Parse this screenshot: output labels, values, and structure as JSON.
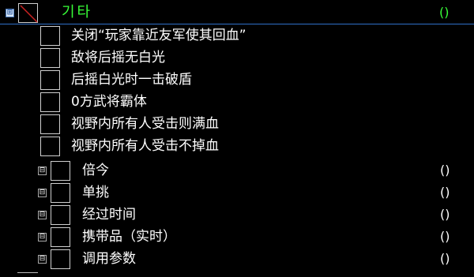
{
  "header": {
    "expander_symbol": "⊞",
    "label": "기타",
    "value": "()"
  },
  "cheats": [
    {
      "label": "关闭“玩家靠近友军使其回血”"
    },
    {
      "label": "敌将后摇无白光"
    },
    {
      "label": "后摇白光时一击破盾"
    },
    {
      "label": "0方武将霸体"
    },
    {
      "label": "视野内所有人受击则满血"
    },
    {
      "label": "视野内所有人受击不掉血"
    }
  ],
  "groups": [
    {
      "expander_symbol": "⊟",
      "label": "倍今",
      "value": "()"
    },
    {
      "expander_symbol": "⊟",
      "label": "单挑",
      "value": "()"
    },
    {
      "expander_symbol": "⊟",
      "label": "经过时间",
      "value": "()"
    },
    {
      "expander_symbol": "⊟",
      "label": "携带品（实时）",
      "value": "()"
    },
    {
      "expander_symbol": "⊟",
      "label": "调用参数",
      "value": "()"
    }
  ],
  "colors": {
    "background": "#000000",
    "header_text": "#38ff38",
    "header_underline": "#2f6fc8",
    "cross_mark": "#cc2222"
  }
}
